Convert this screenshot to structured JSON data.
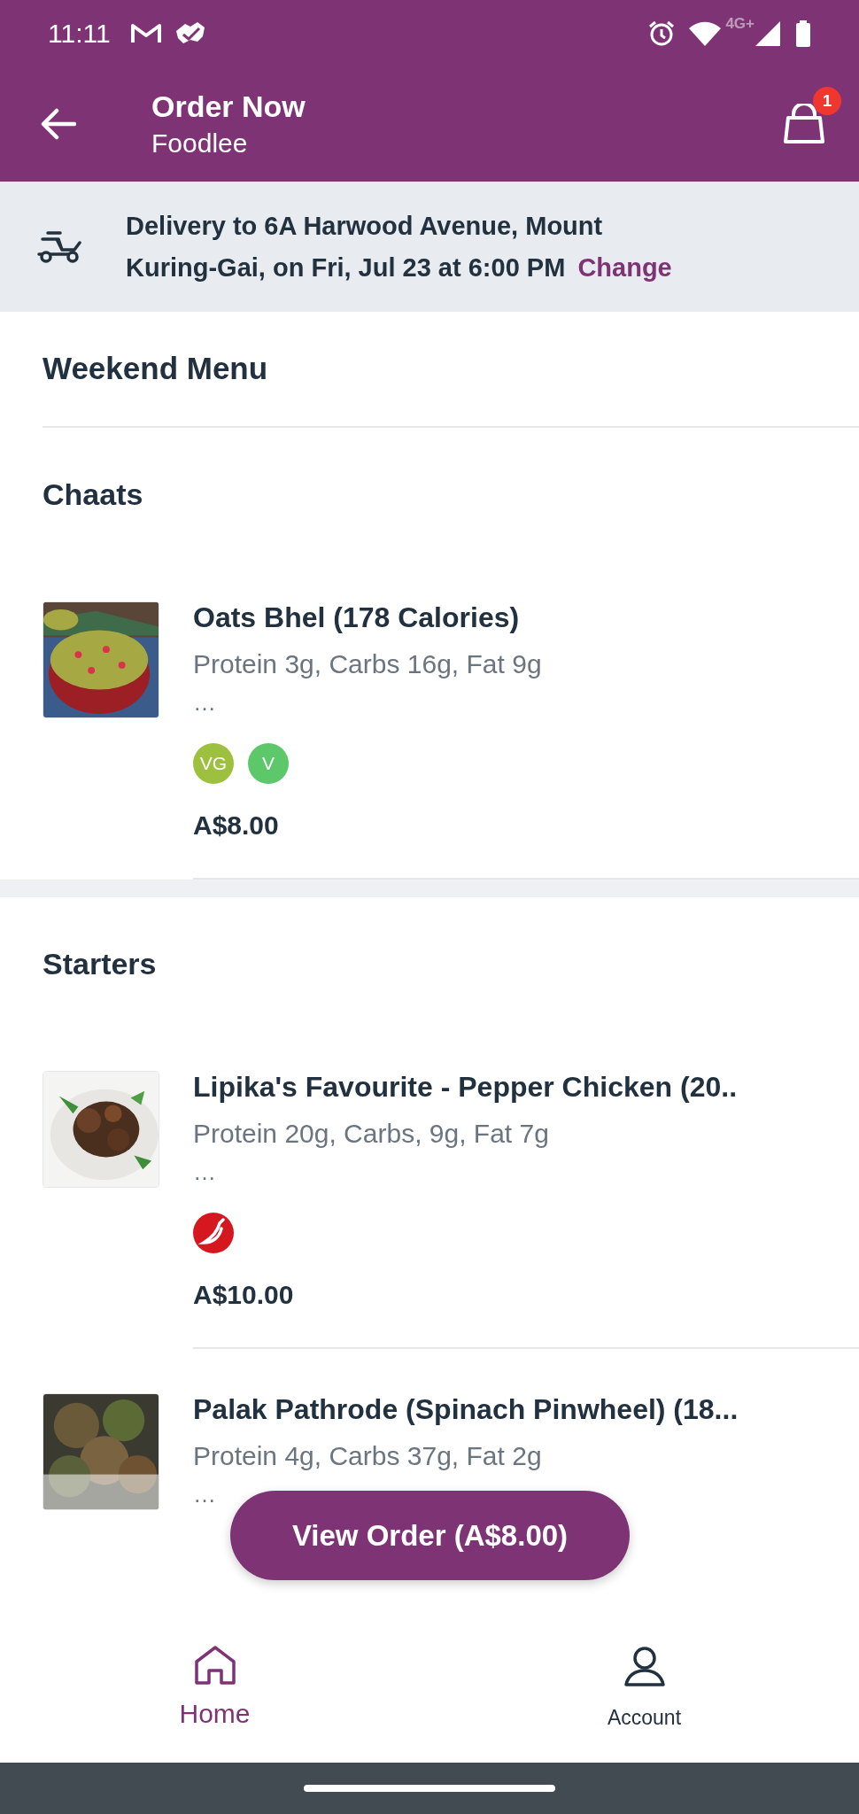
{
  "status_bar": {
    "time": "11:11",
    "network": "4G+"
  },
  "app_bar": {
    "title": "Order Now",
    "subtitle": "Foodlee",
    "cart_count": "1"
  },
  "delivery": {
    "text": "Delivery to 6A Harwood Avenue, Mount Kuring-Gai, on Fri, Jul 23 at 6:00 PM",
    "link": "Change"
  },
  "menu_title": "Weekend Menu",
  "sections": [
    {
      "title": "Chaats",
      "items": [
        {
          "name": "Oats Bhel (178 Calories)",
          "macros": "Protein 3g, Carbs 16g, Fat 9g",
          "more": "…",
          "badges": [
            {
              "kind": "text",
              "label": "VG",
              "color": "#9ec03f"
            },
            {
              "kind": "text",
              "label": "V",
              "color": "#5cc86a"
            }
          ],
          "price": "A$8.00"
        }
      ]
    },
    {
      "title": "Starters",
      "items": [
        {
          "name": "Lipika's Favourite - Pepper Chicken (20..",
          "macros": "Protein 20g, Carbs, 9g, Fat 7g",
          "more": "…",
          "badges": [
            {
              "kind": "chili",
              "color": "#d5171f"
            }
          ],
          "price": "A$10.00"
        },
        {
          "name": "Palak Pathrode (Spinach Pinwheel) (18...",
          "macros": "Protein 4g, Carbs 37g, Fat 2g",
          "more": "…"
        }
      ]
    }
  ],
  "view_order_button": "View Order (A$8.00)",
  "bottom_nav": [
    {
      "label": "Home",
      "selected": true
    },
    {
      "label": "Account",
      "selected": false
    }
  ]
}
